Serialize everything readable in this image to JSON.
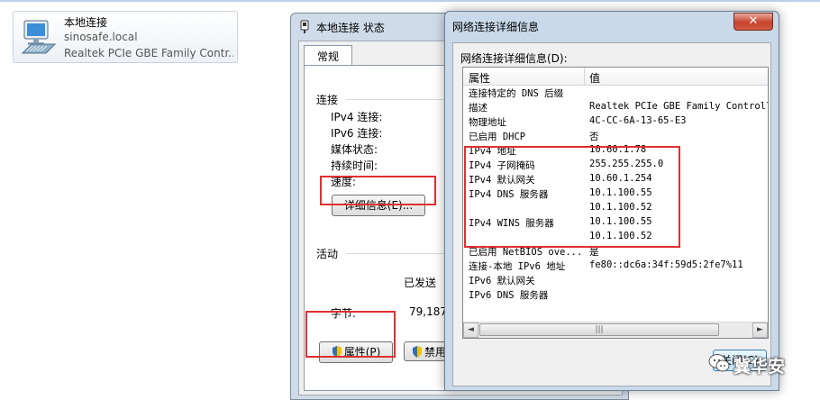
{
  "adapter": {
    "name": "本地连接",
    "domain": "sinosafe.local",
    "device": "Realtek PCIe GBE Family Contr..."
  },
  "status_window": {
    "title": "本地连接 状态",
    "tab": "常规",
    "connection_group": "连接",
    "rows": [
      "IPv4 连接:",
      "IPv6 连接:",
      "媒体状态:",
      "持续时间:",
      "速度:"
    ],
    "details_button": "详细信息(E)...",
    "activity_group": "活动",
    "sent_label": "已发送",
    "bytes_label": "字节:",
    "bytes_sent": "79,187,",
    "properties_button": "属性(P)",
    "disable_button": "禁用"
  },
  "detail_window": {
    "title": "网络连接详细信息",
    "close_glyph": "✕",
    "caption": "网络连接详细信息(D):",
    "columns": {
      "property": "属性",
      "value": "值"
    },
    "rows": [
      {
        "property": "连接特定的 DNS 后缀",
        "value": ""
      },
      {
        "property": "描述",
        "value": "Realtek PCIe GBE Family Controlle"
      },
      {
        "property": "物理地址",
        "value": "4C-CC-6A-13-65-E3"
      },
      {
        "property": "已启用 DHCP",
        "value": "否"
      },
      {
        "property": "IPv4 地址",
        "value": "10.60.1.78"
      },
      {
        "property": "IPv4 子网掩码",
        "value": "255.255.255.0"
      },
      {
        "property": "IPv4 默认网关",
        "value": "10.60.1.254"
      },
      {
        "property": "IPv4 DNS 服务器",
        "value": "10.1.100.55"
      },
      {
        "property": "",
        "value": "10.1.100.52"
      },
      {
        "property": "IPv4 WINS 服务器",
        "value": "10.1.100.55"
      },
      {
        "property": "",
        "value": "10.1.100.52"
      },
      {
        "property": "已启用 NetBIOS ove...",
        "value": "是"
      },
      {
        "property": "连接-本地 IPv6 地址",
        "value": "fe80::dc6a:34f:59d5:2fe7%11"
      },
      {
        "property": "IPv6 默认网关",
        "value": ""
      },
      {
        "property": "IPv6 DNS 服务器",
        "value": ""
      }
    ],
    "scroll_left": "◄",
    "scroll_right": "►",
    "scroll_grip": "|||",
    "close_button": "关闭(C)"
  },
  "watermark": {
    "text": "冀华安"
  },
  "colors": {
    "highlight": "#e03030",
    "titlebar": "#c9d9ea"
  }
}
